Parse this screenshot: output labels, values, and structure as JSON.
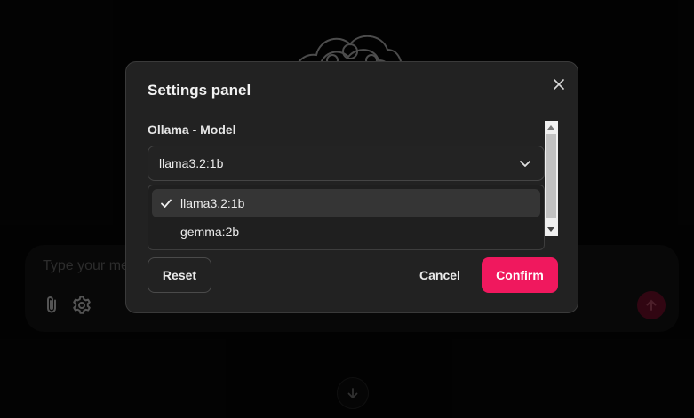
{
  "chat": {
    "input_placeholder": "Type your message...",
    "icons": [
      "paperclip-icon",
      "gear-icon",
      "arrow-up-icon",
      "arrow-down-icon"
    ]
  },
  "modal": {
    "title": "Settings panel",
    "field_label": "Ollama - Model",
    "selected_model": "llama3.2:1b",
    "options": [
      {
        "label": "llama3.2:1b",
        "selected": true
      },
      {
        "label": "gemma:2b",
        "selected": false
      }
    ],
    "buttons": {
      "reset": "Reset",
      "cancel": "Cancel",
      "confirm": "Confirm"
    }
  },
  "colors": {
    "accent": "#f0185e",
    "modal_bg": "#222222",
    "page_bg": "#050505"
  }
}
